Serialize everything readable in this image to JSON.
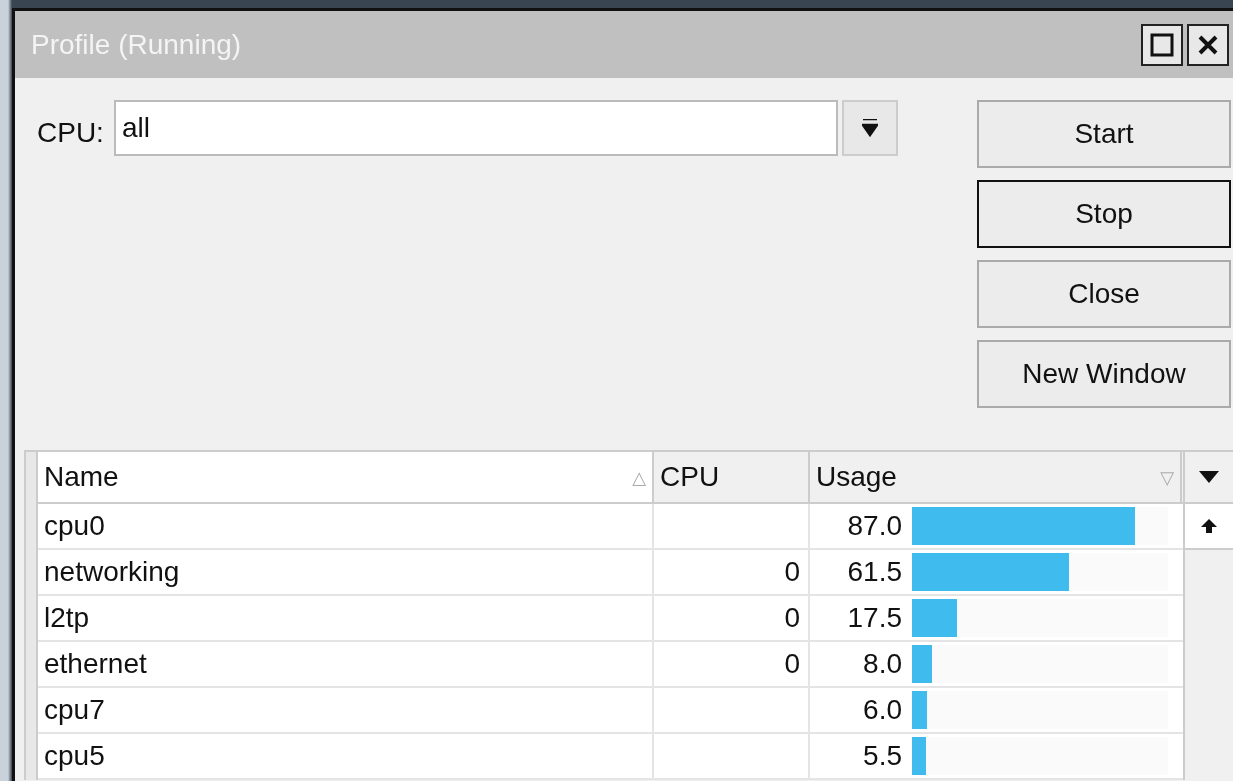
{
  "window": {
    "title": "Profile (Running)"
  },
  "cpu_field": {
    "label": "CPU:",
    "value": "all"
  },
  "buttons": [
    {
      "label": "Start",
      "focused": false
    },
    {
      "label": "Stop",
      "focused": true
    },
    {
      "label": "Close",
      "focused": false
    },
    {
      "label": "New Window",
      "focused": false
    }
  ],
  "table": {
    "columns": [
      {
        "label": "Name",
        "sort_mark": "△"
      },
      {
        "label": "CPU"
      },
      {
        "label": "Usage",
        "sort_mark": "▽"
      }
    ],
    "rows": [
      {
        "name": "cpu0",
        "usage": "87.0",
        "level": 0.87
      },
      {
        "name": "networking",
        "cpu": "0",
        "usage": "61.5",
        "level": 0.615
      },
      {
        "name": "l2tp",
        "cpu": "0",
        "usage": "17.5",
        "level": 0.175
      },
      {
        "name": "ethernet",
        "cpu": "0",
        "usage": "8.0",
        "level": 0.08
      },
      {
        "name": "cpu7",
        "usage": "6.0",
        "level": 0.06
      },
      {
        "name": "cpu5",
        "usage": "5.5",
        "level": 0.055
      }
    ]
  }
}
